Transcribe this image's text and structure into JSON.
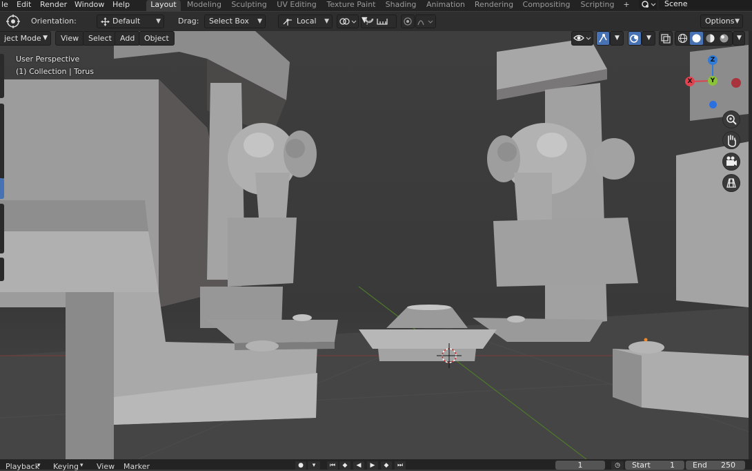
{
  "menu": {
    "file": "le",
    "edit": "Edit",
    "render": "Render",
    "window": "Window",
    "help": "Help"
  },
  "workspaces": [
    "Layout",
    "Modeling",
    "Sculpting",
    "UV Editing",
    "Texture Paint",
    "Shading",
    "Animation",
    "Rendering",
    "Compositing",
    "Scripting"
  ],
  "add_workspace": "+",
  "scene": {
    "label": "Scene"
  },
  "toolbar": {
    "orientation_label": "Orientation:",
    "orientation_value": "Default",
    "drag_label": "Drag:",
    "drag_value": "Select Box",
    "pivot_value": "Local",
    "options_label": "Options"
  },
  "viewport_header": {
    "mode": "ject Mode",
    "view": "View",
    "select": "Select",
    "add": "Add",
    "object": "Object"
  },
  "viewport": {
    "perspective": "User Perspective",
    "collection": "(1) Collection | Torus"
  },
  "gizmo": {
    "z": "Z",
    "y": "Y",
    "x": "X"
  },
  "timeline": {
    "playback": "Playback",
    "keying": "Keying",
    "view": "View",
    "marker": "Marker",
    "current_frame": "1",
    "start_label": "Start",
    "start_value": "1",
    "end_label": "End",
    "end_value": "250"
  },
  "colors": {
    "accent": "#4772b3",
    "x_axis": "#e0434f",
    "y_axis": "#8ac23a",
    "z_axis": "#2f7bd6"
  }
}
